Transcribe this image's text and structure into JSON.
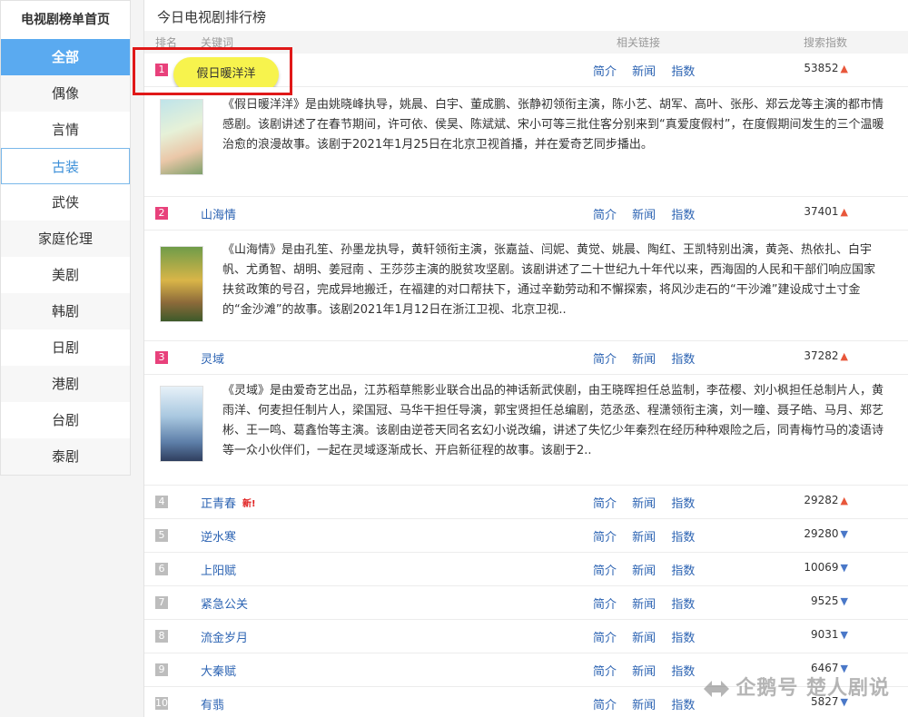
{
  "sidebar": {
    "title": "电视剧榜单首页",
    "items": [
      {
        "label": "全部",
        "state": "active"
      },
      {
        "label": "偶像",
        "state": "alt"
      },
      {
        "label": "言情",
        "state": "normal"
      },
      {
        "label": "古装",
        "state": "selected"
      },
      {
        "label": "武侠",
        "state": "normal"
      },
      {
        "label": "家庭伦理",
        "state": "alt"
      },
      {
        "label": "美剧",
        "state": "normal"
      },
      {
        "label": "韩剧",
        "state": "alt"
      },
      {
        "label": "日剧",
        "state": "normal"
      },
      {
        "label": "港剧",
        "state": "alt"
      },
      {
        "label": "台剧",
        "state": "normal"
      },
      {
        "label": "泰剧",
        "state": "alt"
      }
    ]
  },
  "main": {
    "title": "今日电视剧排行榜",
    "columns": {
      "rank": "排名",
      "keyword": "关键词",
      "links": "相关链接",
      "score": "搜索指数"
    },
    "link_labels": {
      "intro": "简介",
      "news": "新闻",
      "index": "指数"
    },
    "new_label": "新!",
    "rows": [
      {
        "rank": "1",
        "title": "假日暖洋洋",
        "score": "53852",
        "trend": "up",
        "desc": "《假日暖洋洋》是由姚晓峰执导，姚晨、白宇、董成鹏、张静初领衔主演，陈小艺、胡军、高叶、张彤、郑云龙等主演的都市情感剧。该剧讲述了在春节期间，许可依、侯昊、陈斌斌、宋小可等三批住客分别来到“真爱度假村”，在度假期间发生的三个温暖治愈的浪漫故事。该剧于2021年1月25日在北京卫视首播，并在爱奇艺同步播出。"
      },
      {
        "rank": "2",
        "title": "山海情",
        "score": "37401",
        "trend": "up",
        "desc": "《山海情》是由孔笙、孙墨龙执导，黄轩领衔主演，张嘉益、闫妮、黄觉、姚晨、陶红、王凯特别出演，黄尧、热依扎、白宇帆、尤勇智、胡明、姜冠南 、王莎莎主演的脱贫攻坚剧。该剧讲述了二十世纪九十年代以来，西海固的人民和干部们响应国家扶贫政策的号召，完成异地搬迁，在福建的对口帮扶下，通过辛勤劳动和不懈探索，将风沙走石的“干沙滩”建设成寸土寸金的“金沙滩”的故事。该剧2021年1月12日在浙江卫视、北京卫视.."
      },
      {
        "rank": "3",
        "title": "灵域",
        "score": "37282",
        "trend": "up",
        "desc": "《灵域》是由爱奇艺出品，江苏稻草熊影业联合出品的神话新武侠剧，由王晓晖担任总监制，李莅樱、刘小枫担任总制片人，黄雨洋、何麦担任制片人，梁国冠、马华干担任导演，郭宝贤担任总编剧，范丞丞、程潇领衔主演，刘一瞳、聂子皓、马月、郑艺彬、王一鸣、葛鑫怡等主演。该剧由逆苍天同名玄幻小说改编，讲述了失忆少年秦烈在经历种种艰险之后，同青梅竹马的凌语诗等一众小伙伴们，一起在灵域逐渐成长、开启新征程的故事。该剧于2.."
      },
      {
        "rank": "4",
        "title": "正青春",
        "score": "29282",
        "trend": "up",
        "is_new": true
      },
      {
        "rank": "5",
        "title": "逆水寒",
        "score": "29280",
        "trend": "down"
      },
      {
        "rank": "6",
        "title": "上阳赋",
        "score": "10069",
        "trend": "down"
      },
      {
        "rank": "7",
        "title": "紧急公关",
        "score": "9525",
        "trend": "down"
      },
      {
        "rank": "8",
        "title": "流金岁月",
        "score": "9031",
        "trend": "down"
      },
      {
        "rank": "9",
        "title": "大秦赋",
        "score": "6467",
        "trend": "down"
      },
      {
        "rank": "10",
        "title": "有翡",
        "score": "5827",
        "trend": "down"
      }
    ]
  },
  "watermark": "企鹅号 楚人剧说",
  "colors": {
    "active": "#5aaaf0",
    "link": "#2d64b3",
    "hot_rank": "#e8417b",
    "highlight": "#f7f34d",
    "annotation": "#e01818"
  }
}
